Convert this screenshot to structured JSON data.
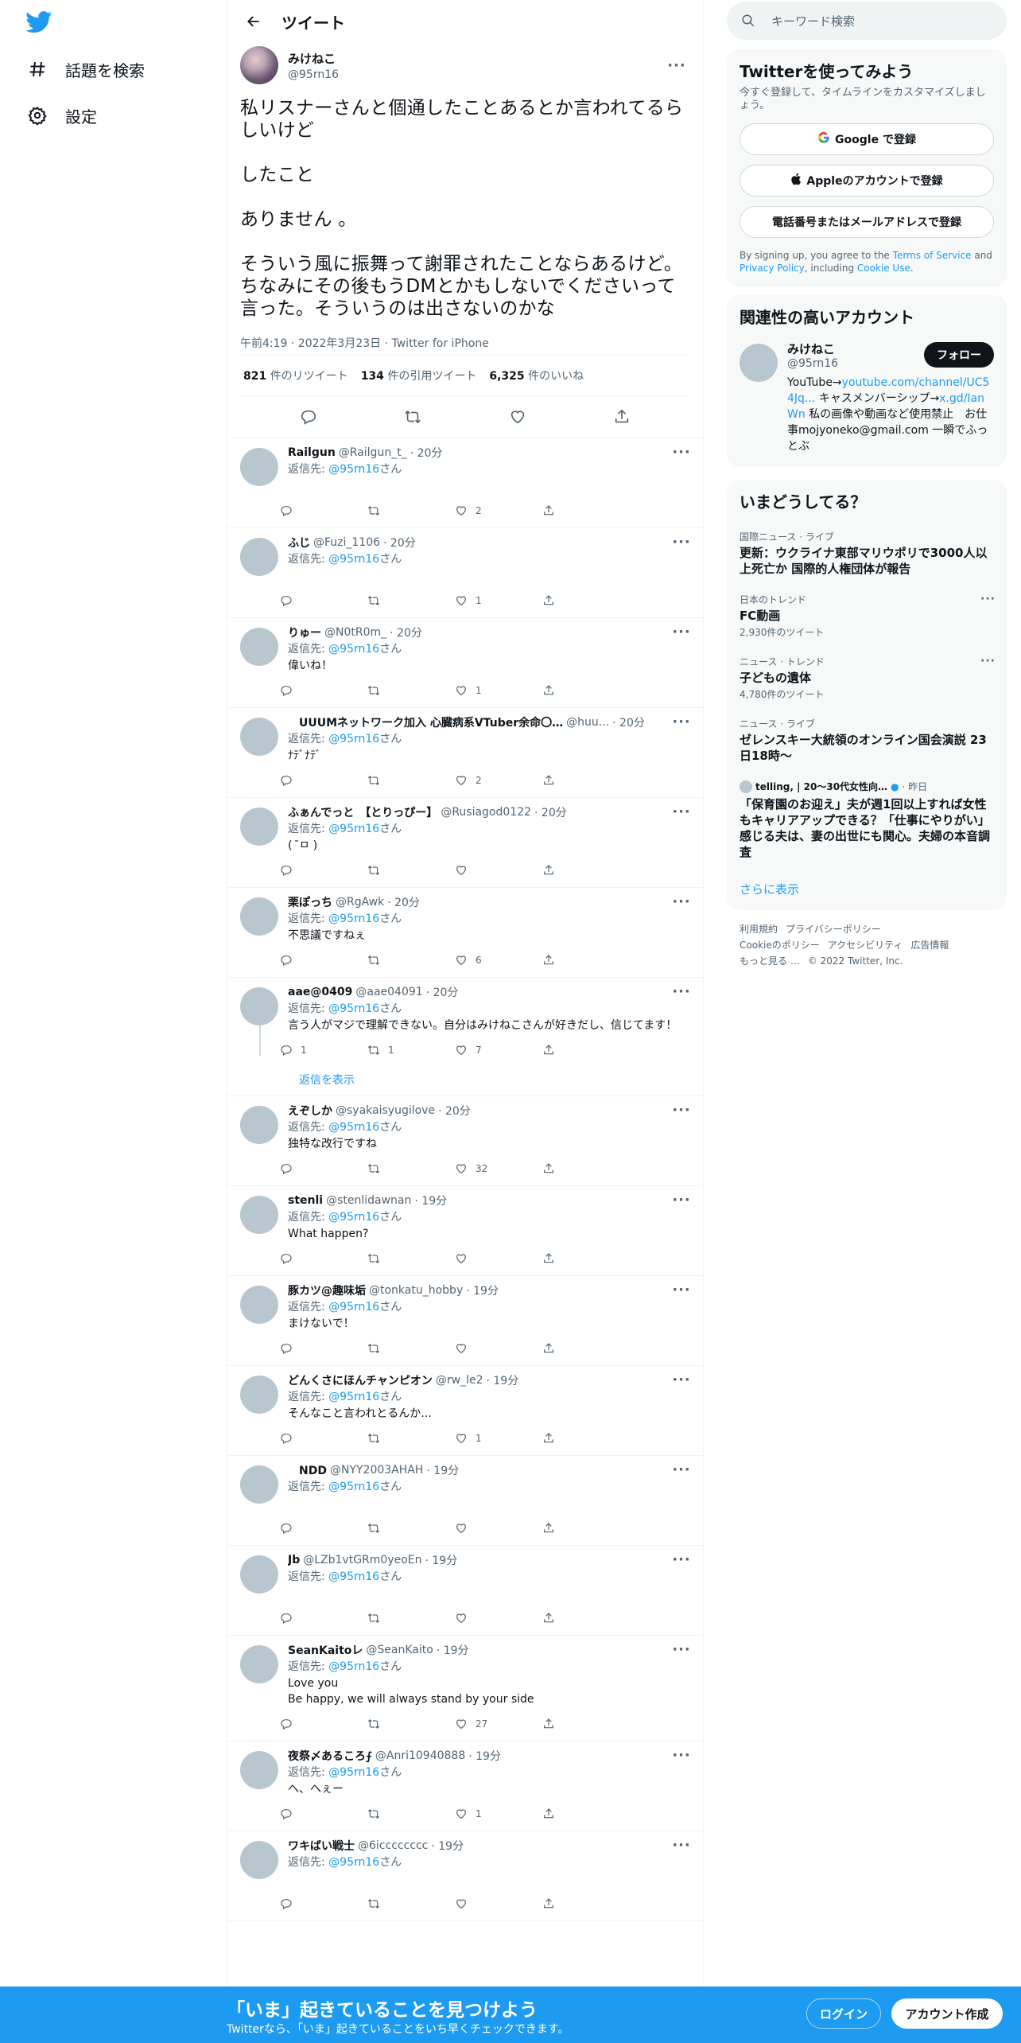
{
  "nav": {
    "explore_label": "話題を検索",
    "settings_label": "設定"
  },
  "header": {
    "title": "ツイート"
  },
  "focal": {
    "name": "みけねこ",
    "handle": "@95rn16",
    "text": "私リスナーさんと個通したことあるとか言われてるらしいけど\n\nしたこと\n\nありません 。\n\nそういう風に振舞って謝罪されたことならあるけど。ちなみにその後もうDMとかもしないでくださいって言った。そういうのは出さないのかな",
    "meta": "午前4:19 · 2022年3月23日 · Twitter for iPhone",
    "retweets": "821",
    "retweets_label": "件のリツイート",
    "quotes": "134",
    "quotes_label": "件の引用ツイート",
    "likes": "6,325",
    "likes_label": "件のいいね"
  },
  "reply_to_label": "返信先: ",
  "reply_to_handle": "@95rn16",
  "reply_to_suffix": "さん",
  "replies": [
    {
      "name": "Railgun",
      "handle": "@Railgun_t_",
      "time": "· 20分",
      "text": "",
      "replies": "",
      "retweets": "",
      "likes": "2"
    },
    {
      "name": "ふじ",
      "handle": "@Fuzi_1106",
      "time": "· 20分",
      "text": "",
      "replies": "",
      "retweets": "",
      "likes": "1"
    },
    {
      "name": "りゅー",
      "handle": "@N0tR0m_",
      "time": "· 20分",
      "text": "偉いね！",
      "replies": "",
      "retweets": "",
      "likes": "1"
    },
    {
      "name": "　UUUMネットワーク加入 心臓病系VTuber余命〇…",
      "handle": "@huu...",
      "time": "· 20分",
      "text": "ﾅﾃﾞﾅﾃﾞ",
      "replies": "",
      "retweets": "",
      "likes": "2"
    },
    {
      "name": "ふぁんでっと　【とりっぴー】",
      "handle": "@Rusiagod0122",
      "time": "· 20分",
      "text": "(  ̄ㅁ )",
      "replies": "",
      "retweets": "",
      "likes": ""
    },
    {
      "name": "栗ぽっち",
      "handle": "@RgAwk",
      "time": "· 20分",
      "text": "不思議ですねぇ",
      "replies": "",
      "retweets": "",
      "likes": "6"
    },
    {
      "name": "aae@0409",
      "handle": "@aae04091",
      "time": "· 20分",
      "text": "言う人がマジで理解できない。自分はみけねこさんが好きだし、信じてます！",
      "replies": "1",
      "retweets": "1",
      "likes": "7",
      "show_replies": "返信を表示"
    },
    {
      "name": "えぞしか",
      "handle": "@syakaisyugilove",
      "time": "· 20分",
      "text": "独特な改行ですね",
      "replies": "",
      "retweets": "",
      "likes": "32"
    },
    {
      "name": "stenli",
      "handle": "@stenlidawnan",
      "time": "· 19分",
      "text": "What happen?",
      "replies": "",
      "retweets": "",
      "likes": ""
    },
    {
      "name": "豚カツ@趣味垢",
      "handle": "@tonkatu_hobby",
      "time": "· 19分",
      "text": "まけないで！",
      "replies": "",
      "retweets": "",
      "likes": ""
    },
    {
      "name": "どんくさにほんチャンピオン",
      "handle": "@rw_le2",
      "time": "· 19分",
      "text": "そんなこと言われとるんか...",
      "replies": "",
      "retweets": "",
      "likes": "1"
    },
    {
      "name": "　NDD",
      "handle": "@NYY2003AHAH",
      "time": "· 19分",
      "text": "",
      "replies": "",
      "retweets": "",
      "likes": ""
    },
    {
      "name": "Jb",
      "handle": "@LZb1vtGRm0yeoEn",
      "time": "· 19分",
      "text": "",
      "replies": "",
      "retweets": "",
      "likes": ""
    },
    {
      "name": "SeanKaitoレ",
      "handle": "@SeanKaito",
      "time": "· 19分",
      "text": "Love you\nBe happy, we will always stand by your side",
      "replies": "",
      "retweets": "",
      "likes": "27"
    },
    {
      "name": "夜祭〆あるころ⨍",
      "handle": "@Anri10940888",
      "time": "· 19分",
      "text": "へ、へぇー",
      "replies": "",
      "retweets": "",
      "likes": "1"
    },
    {
      "name": "ワキばい戦士",
      "handle": "@6icccccccc",
      "time": "· 19分",
      "text": "",
      "replies": "",
      "retweets": "",
      "likes": ""
    }
  ],
  "search": {
    "placeholder": "キーワード検索"
  },
  "signup": {
    "title": "Twitterを使ってみよう",
    "subtitle": "今すぐ登録して、タイムラインをカスタマイズしましょう。",
    "google": "Google で登録",
    "apple": "Appleのアカウントで登録",
    "phone": "電話番号またはメールアドレスで登録",
    "terms_prefix": "By signing up, you agree to the ",
    "terms_link": "Terms of Service",
    "terms_and": " and ",
    "privacy_link": "Privacy Policy",
    "terms_including": ", including ",
    "cookie_link": "Cookie Use",
    "terms_end": "."
  },
  "related": {
    "title": "関連性の高いアカウント",
    "name": "みけねこ",
    "handle": "@95rn16",
    "follow": "フォロー",
    "bio_1": "YouTube→",
    "bio_link1": "youtube.com/channel/UC54Jq...",
    "bio_2": " キャスメンバーシップ→",
    "bio_link2": "x.gd/IanWn",
    "bio_3": " 私の画像や動画など使用禁止　お仕事mojyoneko@gmail.com 一瞬でふっとぶ"
  },
  "trends": {
    "title": "いまどうしてる？",
    "items": [
      {
        "context": "国際ニュース · ライブ",
        "title": "更新：ウクライナ東部マリウポリで3000人以上死亡か 国際的人権団体が報告",
        "count": ""
      },
      {
        "context": "日本のトレンド",
        "title": "FC動画",
        "count": "2,930件のツイート"
      },
      {
        "context": "ニュース · トレンド",
        "title": "子どもの遺体",
        "count": "4,780件のツイート"
      },
      {
        "context": "ニュース · ライブ",
        "title": "ゼレンスキー大統領のオンライン国会演説 23日18時〜",
        "count": ""
      }
    ],
    "promo_source": "telling, | 20～30代女性向…",
    "promo_time": "· 昨日",
    "promo_title": "「保育園のお迎え」夫が週1回以上すれば女性もキャリアアップできる？「仕事にやりがい」感じる夫は、妻の出世にも関心。夫婦の本音調査",
    "show_more": "さらに表示"
  },
  "footer": {
    "links": [
      "利用規約",
      "プライバシーポリシー",
      "Cookieのポリシー",
      "アクセシビリティ",
      "広告情報",
      "もっと見る …"
    ],
    "copyright": "© 2022 Twitter, Inc."
  },
  "bottom": {
    "headline": "「いま」起きていることを見つけよう",
    "sub": "Twitterなら、「いま」起きていることをいち早くチェックできます。",
    "login": "ログイン",
    "signup": "アカウント作成"
  },
  "colors": {
    "accent": "#1d9bf0",
    "text": "#0f1419",
    "muted": "#536471"
  }
}
